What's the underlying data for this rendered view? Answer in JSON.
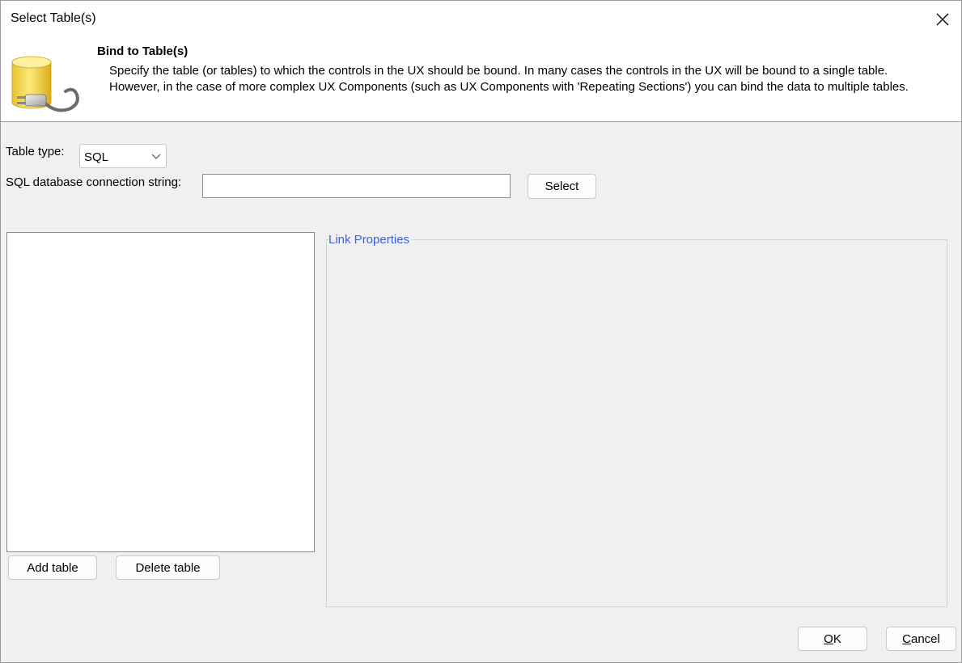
{
  "window": {
    "title": "Select Table(s)",
    "close_icon": "close-icon"
  },
  "banner": {
    "icon": "database-plug-icon",
    "heading": "Bind to Table(s)",
    "description": "Specify the table (or tables) to which the controls in the UX should be bound. In many cases the controls in the UX will be bound to a single table. However, in the case of more complex UX Components (such as UX Components with 'Repeating Sections') you can bind the data to multiple tables."
  },
  "form": {
    "table_type_label": "Table type:",
    "table_type_value": "SQL",
    "connection_label": "SQL database connection string:",
    "connection_value": "",
    "select_button": "Select"
  },
  "tables": {
    "items": [],
    "add_button": "Add table",
    "delete_button": "Delete table"
  },
  "link_properties": {
    "label": "Link Properties"
  },
  "footer": {
    "ok_mnemonic": "O",
    "ok_rest": "K",
    "cancel_mnemonic": "C",
    "cancel_rest": "ancel"
  },
  "colors": {
    "accent_link": "#3a63e0",
    "dialog_bg": "#f0f0f0",
    "banner_bg": "#ffffff"
  }
}
